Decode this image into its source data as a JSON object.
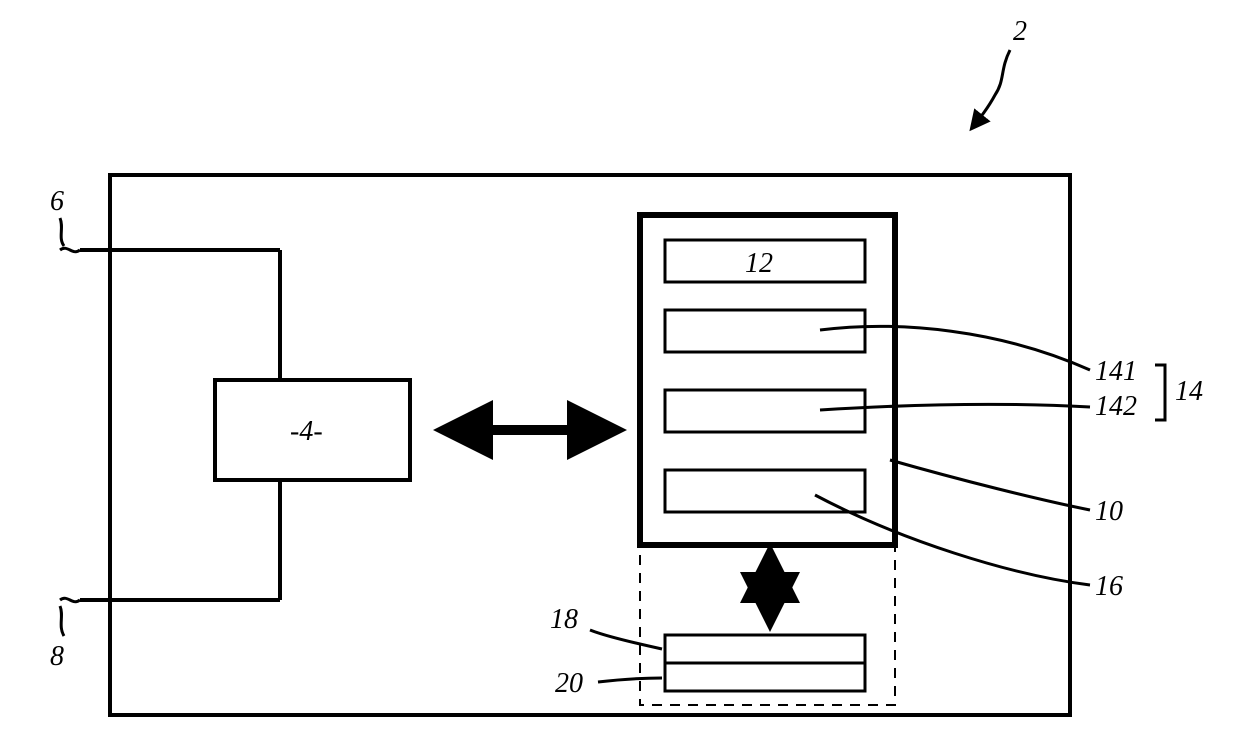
{
  "diagram": {
    "assembly_label": "2",
    "port_top_label": "6",
    "port_bottom_label": "8",
    "left_block_label": "-4-",
    "module_container_label": "10",
    "inner_blocks": {
      "b1_label": "12",
      "b2_label": "141",
      "b3_label": "142",
      "b4_label": "16"
    },
    "group_14_label": "14",
    "dashed_block_top_label": "18",
    "dashed_block_bottom_label": "20"
  }
}
